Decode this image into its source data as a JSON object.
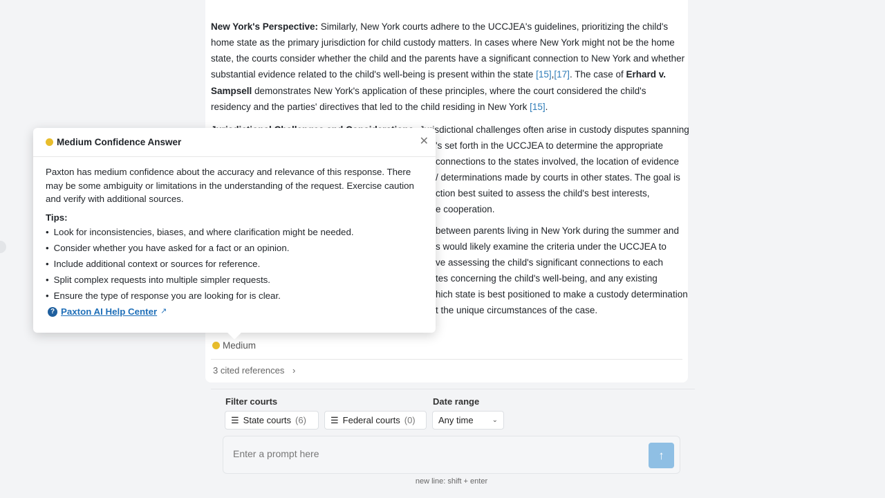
{
  "answer": {
    "ny_heading": "New York's Perspective:",
    "ny_l1": " Similarly, New York courts adhere to the UCCJEA's guidelines, prioritizing the child's",
    "ny_l2": "home state as the primary jurisdiction for child custody matters. In cases where New York might not be the home",
    "ny_l3": "state, the courts consider whether the child and the parents have a significant connection to New York and whether",
    "ny_l4": "substantial evidence related to the child's well-being is present within the state ",
    "cite15": "[15]",
    "cite17": "[17]",
    "ny_l4b": ". The case of ",
    "case_a": "Erhard v.",
    "case_b": "Sampsell",
    "ny_l5": " demonstrates New York's application of these principles, where the court considered the child's",
    "ny_l6": "residency and the parties' directives that led to the child residing in New York ",
    "jc_heading": "Jurisdictional Challenges and Considerations:",
    "jc_l1": " Jurisdictional challenges often arise in custody disputes spanning",
    "frags": [
      "'s set forth in the UCCJEA to determine the appropriate",
      " connections to the states involved, the location of evidence",
      "/ determinations made by courts in other states. The goal is",
      "ction best suited to assess the child's best interests,",
      "e cooperation."
    ],
    "frags2": [
      " between parents living in New York during the summer and",
      "s would likely examine the criteria under the UCCJEA to",
      "ve assessing the child's significant connections to each",
      "tes concerning the child's well-being, and any existing",
      "hich state is best positioned to make a custody determination",
      "t the unique circumstances of the case."
    ],
    "confidence": "Medium",
    "refs": "3 cited references"
  },
  "popup": {
    "title": "Medium Confidence Answer",
    "body": "Paxton has medium confidence about the accuracy and relevance of this response. There may be some ambiguity or limitations in the understanding of the request. Exercise caution and verify with additional sources.",
    "tips_label": "Tips:",
    "tips": [
      "Look for inconsistencies, biases, and where clarification might be needed.",
      "Consider whether you have asked for a fact or an opinion.",
      "Include additional context or sources for reference.",
      "Split complex requests into multiple simpler requests.",
      "Ensure the type of response you are looking for is clear."
    ],
    "help_link": "Paxton AI Help Center",
    "confidence_color": "#e8bd2c"
  },
  "filters": {
    "filter_label": "Filter courts",
    "date_label": "Date range",
    "state": "State courts",
    "state_count": "(6)",
    "federal": "Federal courts",
    "federal_count": "(0)",
    "date_value": "Any time"
  },
  "prompt": {
    "placeholder": "Enter a prompt here",
    "hint": "new line: shift + enter"
  }
}
